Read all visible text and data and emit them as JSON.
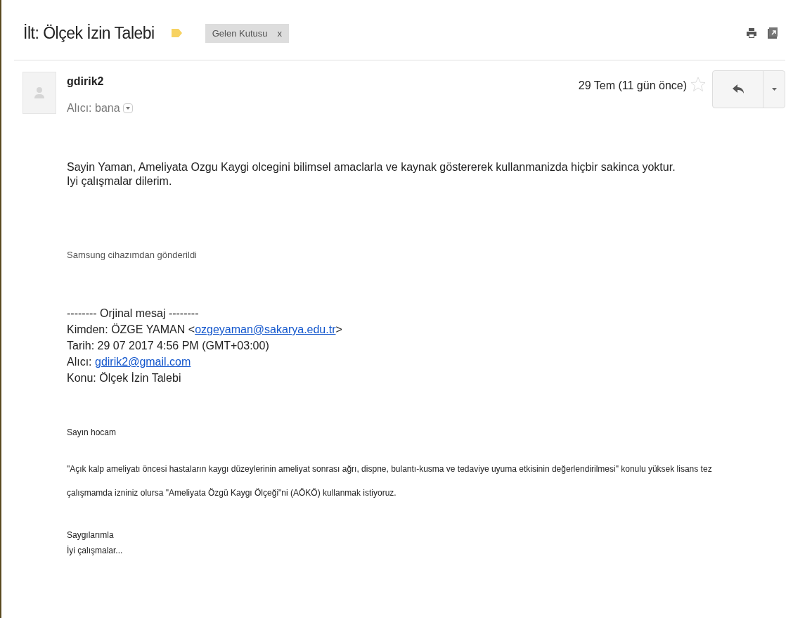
{
  "subject": "İlt: Ölçek İzin Talebi",
  "label": {
    "text": "Gelen Kutusu",
    "remove": "x"
  },
  "message": {
    "sender": "gdirik2",
    "recipient": "Alıcı: bana",
    "date": "29 Tem (11 gün önce)",
    "starred": false,
    "body": [
      "Sayin Yaman, Ameliyata Ozgu  Kaygi olcegini bilimsel amaclarla ve kaynak göstererek kullanmanizda hiçbir sakinca yoktur.",
      "Iyi çalışmalar dilerim."
    ],
    "signature": "Samsung cihazımdan gönderildi",
    "original": {
      "separator": "-------- Orjinal mesaj --------",
      "from_prefix": "Kimden: ÖZGE YAMAN <",
      "from_email": "ozgeyaman@sakarya.edu.tr",
      "from_suffix": ">",
      "date": "Tarih: 29 07 2017 4:56 PM (GMT+03:00)",
      "to_prefix": "Alıcı: ",
      "to_email": "gdirik2@gmail.com",
      "subject": "Konu: Ölçek İzin Talebi"
    },
    "quoted": {
      "greeting": "Sayın hocam",
      "paragraph": "\"Açık kalp ameliyatı öncesi hastaların kaygı düzeylerinin ameliyat sonrası ağrı, dispne, bulantı-kusma ve tedaviye uyuma etkisinin değerlendirilmesi\" konulu yüksek lisans tez çalışmamda izniniz olursa \"Ameliyata Özgü Kaygı Ölçeği\"ni (AÖKÖ) kullanmak istiyoruz.",
      "closing": [
        "Saygılarımla",
        "İyi çalışmalar..."
      ]
    }
  }
}
